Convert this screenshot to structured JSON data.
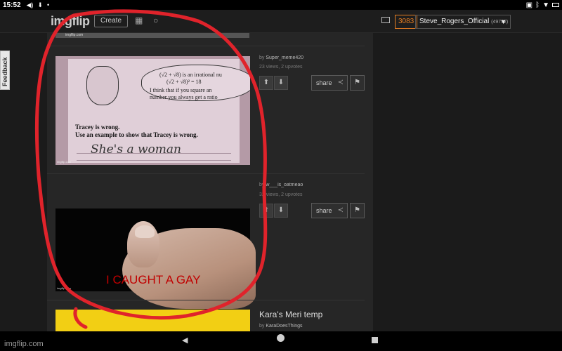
{
  "statusbar": {
    "time": "15:52"
  },
  "header": {
    "logo": "imgflip",
    "create_label": "Create",
    "points": "3083",
    "username": "Steve_Rogers_Official",
    "user_points": "(49752)"
  },
  "feedback_label": "Feedback",
  "previous_post": {
    "tag": "imgflip.com"
  },
  "posts": [
    {
      "by_prefix": "by",
      "author": "Super_meme420",
      "stats": "23 views, 2 upvotes",
      "share_label": "share",
      "image": {
        "line1": "(√2 + √8) is an irrational nu",
        "line2": "(√2 + √8)² = 18",
        "line3": "I think that if you square an",
        "line4": "number you always get a ratio",
        "bold1": "Tracey is wrong.",
        "bold2": "Use an example to show that Tracey is wrong.",
        "handwriting": "She's a woman",
        "tag": "imgflip.com"
      }
    },
    {
      "by_prefix": "by",
      "author": "w___is_oatmeao",
      "stats": "32 views, 2 upvotes",
      "share_label": "share",
      "image": {
        "caption": "I CAUGHT A GAY",
        "tag": "imgflip.com"
      }
    },
    {
      "title": "Kara's Meri temp",
      "by_prefix": "by",
      "author": "KaraDoesThings"
    }
  ],
  "watermark": "imgflip.com",
  "colors": {
    "accent": "#e67e22",
    "annotation": "#e0232b"
  }
}
